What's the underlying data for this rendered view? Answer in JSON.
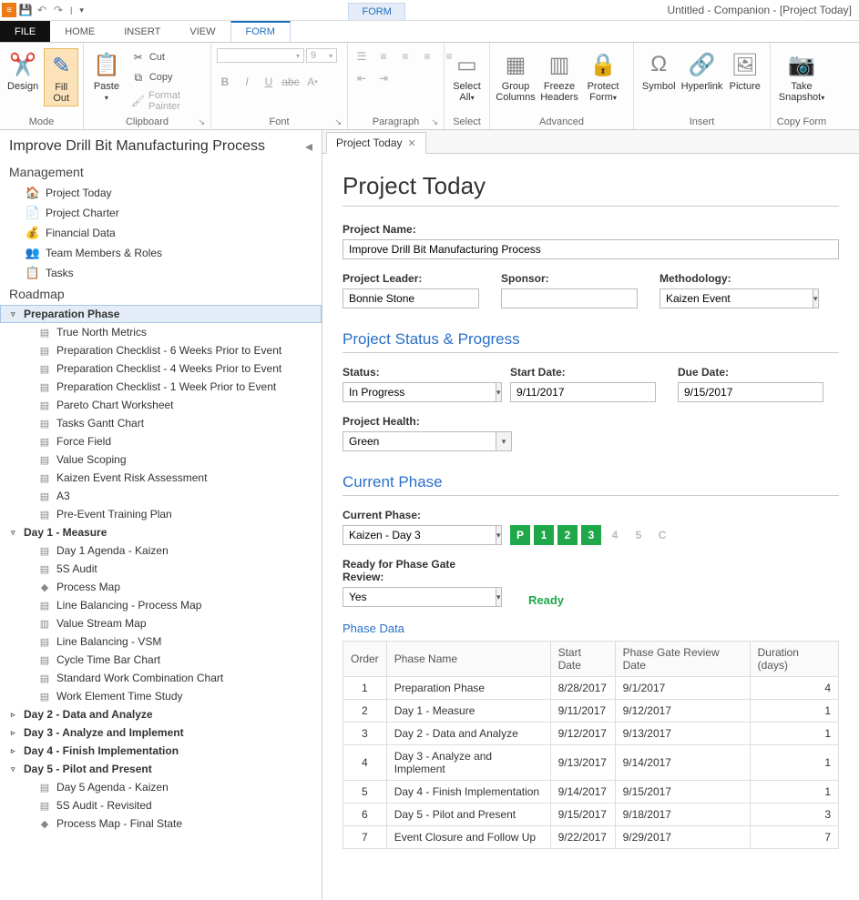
{
  "window_title": "Untitled - Companion - [Project Today]",
  "menu_tabs": {
    "file": "FILE",
    "home": "HOME",
    "insert": "INSERT",
    "view": "VIEW",
    "form": "FORM",
    "form_hi": "FORM"
  },
  "ribbon": {
    "mode": {
      "design": "Design",
      "fillout": "Fill\nOut",
      "label": "Mode"
    },
    "clipboard": {
      "paste": "Paste",
      "cut": "Cut",
      "copy": "Copy",
      "fp": "Format Painter",
      "label": "Clipboard"
    },
    "font": {
      "size": "9",
      "label": "Font"
    },
    "paragraph": {
      "label": "Paragraph"
    },
    "select": {
      "all": "Select\nAll",
      "label": "Select"
    },
    "advanced": {
      "group": "Group\nColumns",
      "freeze": "Freeze\nHeaders",
      "protect": "Protect\nForm",
      "label": "Advanced"
    },
    "insert": {
      "symbol": "Symbol",
      "hyperlink": "Hyperlink",
      "picture": "Picture",
      "label": "Insert"
    },
    "copyform": {
      "snapshot": "Take\nSnapshot",
      "label": "Copy Form"
    }
  },
  "sidebar": {
    "title": "Improve Drill Bit Manufacturing Process",
    "management_head": "Management",
    "management": [
      {
        "label": "Project Today",
        "icon": "🏠",
        "cls": "ic-orange"
      },
      {
        "label": "Project Charter",
        "icon": "📄",
        "cls": "ic-gray"
      },
      {
        "label": "Financial Data",
        "icon": "💰",
        "cls": "ic-gold"
      },
      {
        "label": "Team Members & Roles",
        "icon": "👥",
        "cls": "ic-blue"
      },
      {
        "label": "Tasks",
        "icon": "📋",
        "cls": "ic-orange"
      }
    ],
    "roadmap_head": "Roadmap",
    "tree": [
      {
        "label": "Preparation Phase",
        "expanded": true,
        "selected": true,
        "children": [
          "True North Metrics",
          "Preparation Checklist - 6 Weeks Prior to Event",
          "Preparation Checklist - 4 Weeks Prior to Event",
          "Preparation Checklist - 1 Week Prior to Event",
          "Pareto Chart Worksheet",
          "Tasks Gantt Chart",
          "Force Field",
          "Value Scoping",
          "Kaizen Event Risk Assessment",
          "A3",
          "Pre-Event Training Plan"
        ]
      },
      {
        "label": "Day 1 - Measure",
        "expanded": true,
        "children": [
          "Day 1 Agenda - Kaizen",
          "5S Audit",
          "Process Map",
          "Line Balancing - Process Map",
          "Value Stream Map",
          "Line Balancing - VSM",
          "Cycle Time Bar Chart",
          "Standard Work Combination Chart",
          "Work Element Time Study"
        ]
      },
      {
        "label": "Day 2 - Data and Analyze",
        "expanded": false
      },
      {
        "label": "Day 3 - Analyze and Implement",
        "expanded": false
      },
      {
        "label": "Day 4 - Finish Implementation",
        "expanded": false
      },
      {
        "label": "Day 5 - Pilot and Present",
        "expanded": true,
        "children": [
          "Day 5 Agenda - Kaizen",
          "5S Audit - Revisited",
          "Process Map - Final State"
        ]
      }
    ],
    "leaf_icons": {
      "Process Map": {
        "icon": "◆",
        "cls": "ic-green"
      },
      "Value Stream Map": {
        "icon": "▥",
        "cls": "ic-gold"
      },
      "Process Map - Final State": {
        "icon": "◆",
        "cls": "ic-green"
      }
    }
  },
  "tab": {
    "title": "Project Today"
  },
  "form": {
    "title": "Project Today",
    "labels": {
      "project_name": "Project Name:",
      "project_leader": "Project Leader:",
      "sponsor": "Sponsor:",
      "methodology": "Methodology:",
      "status_section": "Project Status & Progress",
      "status": "Status:",
      "start_date": "Start Date:",
      "due_date": "Due Date:",
      "health": "Project Health:",
      "phase_section": "Current Phase",
      "current_phase": "Current Phase:",
      "ready_gate": "Ready for Phase Gate Review:",
      "ready": "Ready",
      "phase_data": "Phase Data"
    },
    "values": {
      "project_name": "Improve Drill Bit Manufacturing Process",
      "project_leader": "Bonnie Stone",
      "sponsor": "",
      "methodology": "Kaizen Event",
      "status": "In Progress",
      "start_date": "9/11/2017",
      "due_date": "9/15/2017",
      "health": "Green",
      "current_phase": "Kaizen - Day 3",
      "ready_gate": "Yes"
    },
    "phase_boxes": [
      "P",
      "1",
      "2",
      "3",
      "4",
      "5",
      "C"
    ],
    "phase_done_count": 4,
    "table": {
      "headers": [
        "Order",
        "Phase Name",
        "Start Date",
        "Phase Gate Review Date",
        "Duration (days)"
      ],
      "rows": [
        [
          "1",
          "Preparation Phase",
          "8/28/2017",
          "9/1/2017",
          "4"
        ],
        [
          "2",
          "Day 1 - Measure",
          "9/11/2017",
          "9/12/2017",
          "1"
        ],
        [
          "3",
          "Day 2 - Data and Analyze",
          "9/12/2017",
          "9/13/2017",
          "1"
        ],
        [
          "4",
          "Day 3 - Analyze and Implement",
          "9/13/2017",
          "9/14/2017",
          "1"
        ],
        [
          "5",
          "Day 4 - Finish Implementation",
          "9/14/2017",
          "9/15/2017",
          "1"
        ],
        [
          "6",
          "Day 5 - Pilot and Present",
          "9/15/2017",
          "9/18/2017",
          "3"
        ],
        [
          "7",
          "Event Closure and Follow Up",
          "9/22/2017",
          "9/29/2017",
          "7"
        ]
      ]
    }
  }
}
